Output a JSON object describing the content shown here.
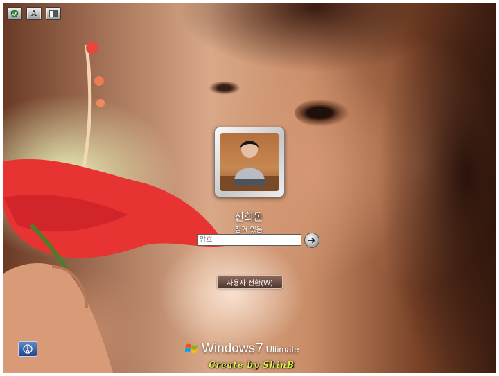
{
  "toolbar": {
    "icons": [
      "shield-check-icon",
      "text-size-icon",
      "contrast-icon"
    ],
    "font_glyph": "A"
  },
  "user": {
    "name": "신희돈",
    "status": "잠겨 있음",
    "icon": "user-avatar"
  },
  "password": {
    "placeholder": "암호",
    "submit_icon": "arrow-right-icon"
  },
  "switch_user": {
    "label": "사용자 전환(W)"
  },
  "ease_of_access": {
    "icon": "ease-of-access-icon"
  },
  "branding": {
    "windows": "Windows",
    "version": "7",
    "edition": "Ultimate",
    "logo_colors": [
      "#f25022",
      "#7fba00",
      "#00a4ef",
      "#ffb900"
    ]
  },
  "credit": "Create by ShinB"
}
